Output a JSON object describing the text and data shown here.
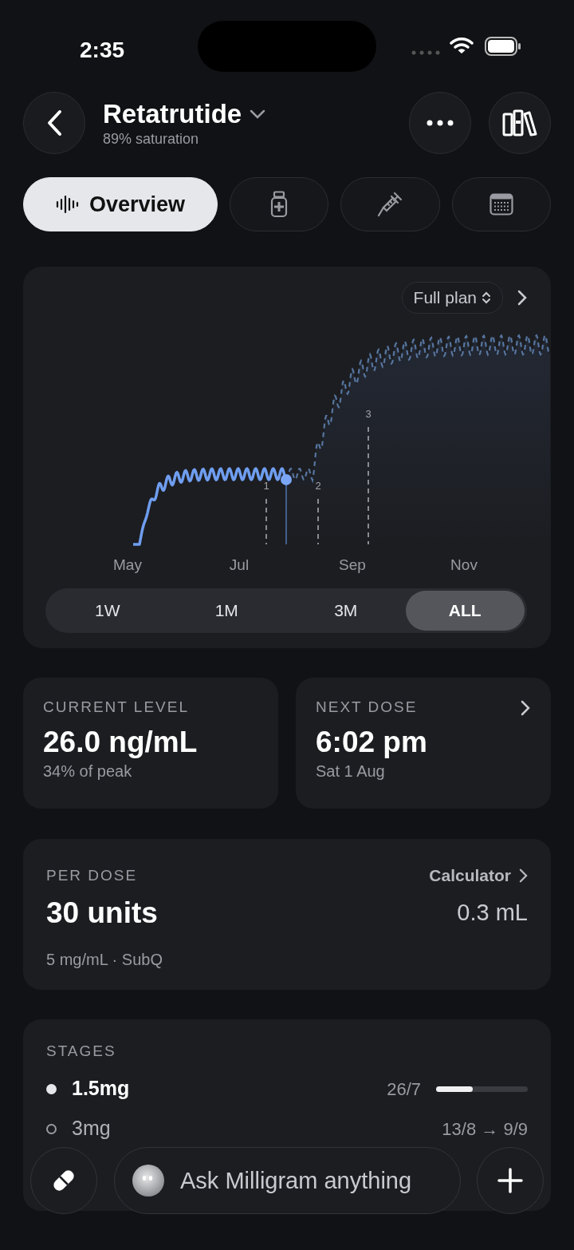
{
  "status_bar": {
    "time": "2:35"
  },
  "header": {
    "title": "Retatrutide",
    "subtitle": "89% saturation"
  },
  "tabs": [
    {
      "kind": "overview",
      "label": "Overview",
      "selected": true
    },
    {
      "kind": "vial",
      "selected": false
    },
    {
      "kind": "syringe",
      "selected": false
    },
    {
      "kind": "calendar",
      "selected": false
    }
  ],
  "chart": {
    "plan_selector": "Full plan",
    "markers": [
      "1",
      "2",
      "3"
    ],
    "x_labels": [
      "May",
      "Jul",
      "Sep",
      "Nov"
    ],
    "ranges": [
      {
        "label": "1W",
        "selected": false
      },
      {
        "label": "1M",
        "selected": false
      },
      {
        "label": "3M",
        "selected": false
      },
      {
        "label": "ALL",
        "selected": true
      }
    ]
  },
  "current_level": {
    "label": "CURRENT LEVEL",
    "value": "26.0 ng/mL",
    "detail": "34% of peak"
  },
  "next_dose": {
    "label": "NEXT DOSE",
    "value": "6:02 pm",
    "detail": "Sat 1 Aug"
  },
  "per_dose": {
    "label": "PER DOSE",
    "link": "Calculator",
    "value": "30 units",
    "volume": "0.3 mL",
    "detail": "5 mg/mL · SubQ"
  },
  "stages": {
    "title": "STAGES",
    "items": [
      {
        "name": "1.5mg",
        "dates": "26/7",
        "current": true,
        "level": 0.4
      },
      {
        "name": "3mg",
        "dates": "13/8 → 9/9",
        "current": false
      }
    ]
  },
  "ask_bar": {
    "placeholder": "Ask Milligram anything"
  }
}
